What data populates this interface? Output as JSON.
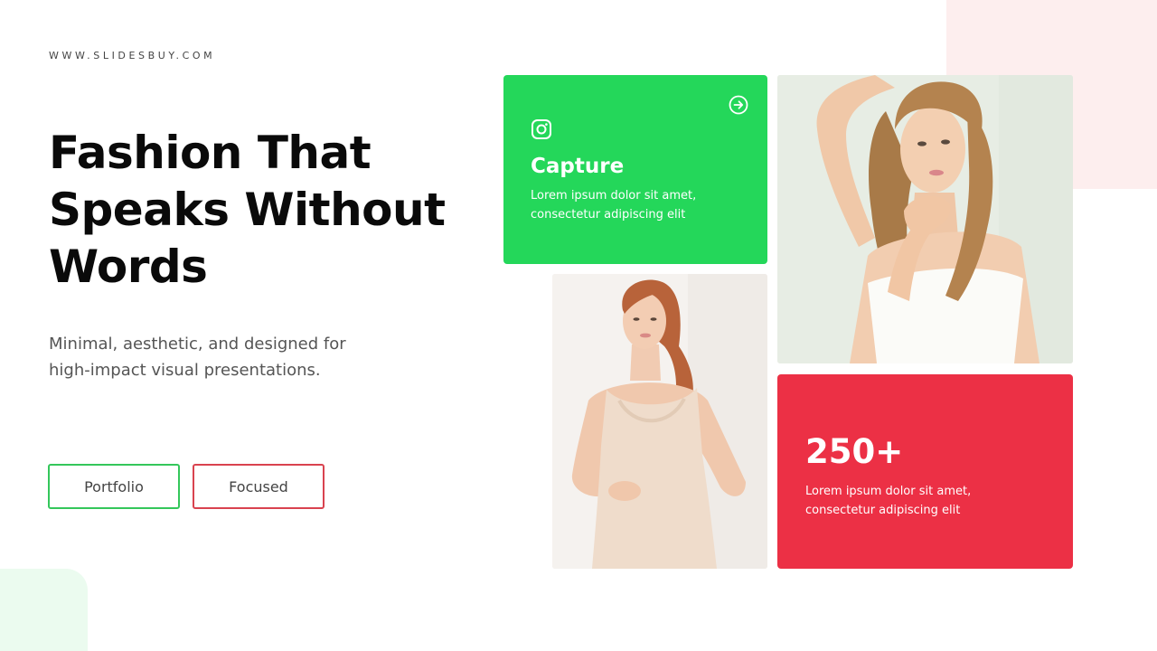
{
  "site": {
    "url": "WWW.SLIDESBUY.COM"
  },
  "hero": {
    "title": "Fashion That Speaks Without Words",
    "description": "Minimal, aesthetic, and designed for high-impact visual presentations."
  },
  "buttons": {
    "portfolio": "Portfolio",
    "focused": "Focused"
  },
  "feature_card": {
    "title": "Capture",
    "text": "Lorem ipsum dolor sit amet, consectetur adipiscing elit",
    "icon": "instagram-icon",
    "action_icon": "arrow-right-circle-icon"
  },
  "stat_card": {
    "value": "250+",
    "text": "Lorem ipsum dolor sit amet, consectetur adipiscing elit"
  },
  "colors": {
    "accent_green": "#24d75a",
    "accent_red": "#ec3045",
    "pink_tint": "#fdeeee",
    "mint_tint": "#ebfbef"
  }
}
